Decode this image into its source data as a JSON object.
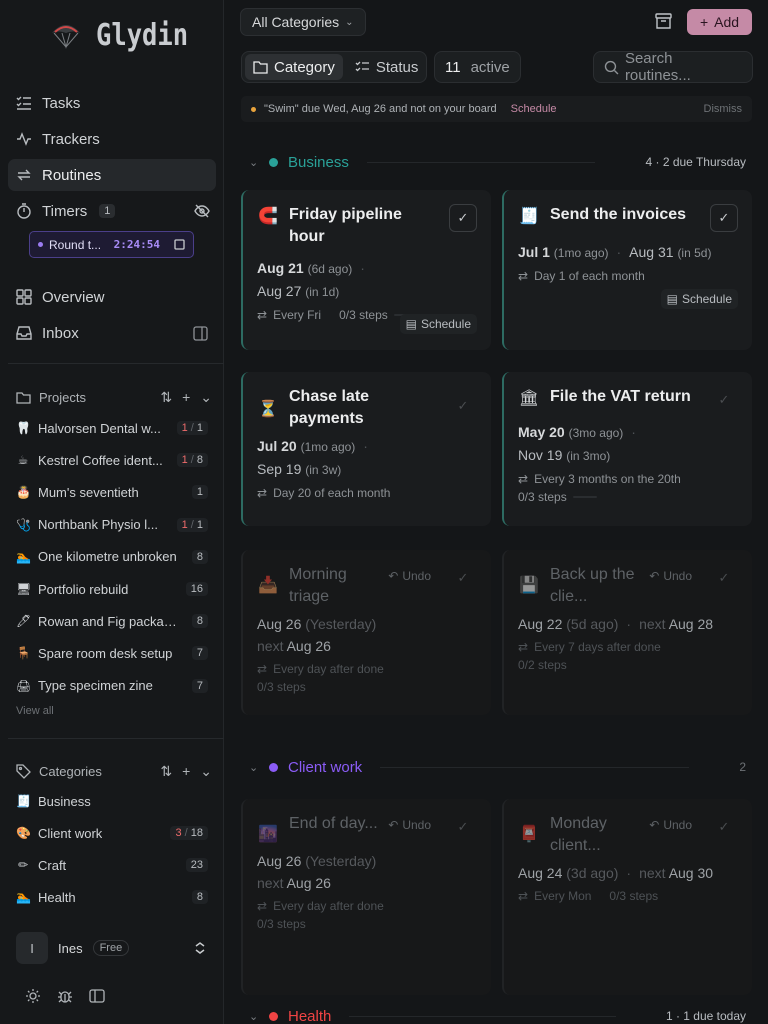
{
  "app": {
    "name": "Glydin"
  },
  "nav": {
    "tasks": "Tasks",
    "trackers": "Trackers",
    "routines": "Routines",
    "timers": "Timers",
    "timers_count": "1",
    "overview": "Overview",
    "inbox": "Inbox"
  },
  "timer": {
    "label": "Round t...",
    "time": "2:24:54"
  },
  "projects": {
    "title": "Projects",
    "items": [
      {
        "emoji": "🦷",
        "label": "Halvorsen Dental w...",
        "overdue": "1",
        "total": "1"
      },
      {
        "emoji": "☕",
        "label": "Kestrel Coffee ident...",
        "overdue": "1",
        "total": "8"
      },
      {
        "emoji": "🎂",
        "label": "Mum's seventieth",
        "count": "1"
      },
      {
        "emoji": "🩺",
        "label": "Northbank Physio l...",
        "overdue": "1",
        "total": "1"
      },
      {
        "emoji": "🏊",
        "label": "One kilometre unbroken",
        "count": "8"
      },
      {
        "emoji": "🖥",
        "label": "Portfolio rebuild",
        "count": "16"
      },
      {
        "emoji": "🖊",
        "label": "Rowan and Fig packagi...",
        "count": "8"
      },
      {
        "emoji": "🪑",
        "label": "Spare room desk setup",
        "count": "7"
      },
      {
        "emoji": "🖨",
        "label": "Type specimen zine",
        "count": "7"
      }
    ],
    "view_all": "View all"
  },
  "categories": {
    "title": "Categories",
    "items": [
      {
        "emoji": "🧾",
        "label": "Business"
      },
      {
        "emoji": "🎨",
        "label": "Client work",
        "overdue": "3",
        "total": "18"
      },
      {
        "emoji": "✏",
        "label": "Craft",
        "count": "23"
      },
      {
        "emoji": "🏊",
        "label": "Health",
        "count": "8"
      }
    ]
  },
  "user": {
    "initial": "I",
    "name": "Ines",
    "plan": "Free"
  },
  "toolbar": {
    "filter": "All Categories",
    "add": "Add",
    "seg_category": "Category",
    "seg_status": "Status",
    "active_num": "11",
    "active_word": "active",
    "search_placeholder": "Search routines..."
  },
  "notice": {
    "text": "\"Swim\" due Wed, Aug 26 and not on your board",
    "action": "Schedule",
    "dismiss": "Dismiss"
  },
  "groups": {
    "business": {
      "name": "Business",
      "meta": "4 · 2 due Thursday",
      "color": "#2aa198"
    },
    "client": {
      "name": "Client work",
      "meta": "2",
      "color": "#8b5cf6"
    },
    "health": {
      "name": "Health",
      "meta": "1 · 1 due today",
      "color": "#ef4444"
    }
  },
  "cards": {
    "friday": {
      "emoji": "🧲",
      "title": "Friday pipeline hour",
      "last": "Aug 21",
      "last_rel": "(6d ago)",
      "next": "Aug 27",
      "next_rel": "(in 1d)",
      "repeat": "Every Fri",
      "steps": "0/3 steps",
      "schedule": "Schedule"
    },
    "invoices": {
      "emoji": "🧾",
      "title": "Send the invoices",
      "last": "Jul 1",
      "last_rel": "(1mo ago)",
      "next": "Aug 31",
      "next_rel": "(in 5d)",
      "repeat": "Day 1 of each month",
      "schedule": "Schedule"
    },
    "chase": {
      "emoji": "⏳",
      "title": "Chase late payments",
      "last": "Jul 20",
      "last_rel": "(1mo ago)",
      "next": "Sep 19",
      "next_rel": "(in 3w)",
      "repeat": "Day 20 of each month"
    },
    "vat": {
      "emoji": "🏛",
      "title": "File the VAT return",
      "last": "May 20",
      "last_rel": "(3mo ago)",
      "next": "Nov 19",
      "next_rel": "(in 3mo)",
      "repeat": "Every 3 months on the 20th",
      "steps": "0/3 steps"
    },
    "triage": {
      "emoji": "📥",
      "title": "Morning triage",
      "undo": "Undo",
      "last": "Aug 26",
      "last_rel": "(Yesterday)",
      "next_word": "next",
      "next": "Aug 26",
      "repeat": "Every day after done",
      "steps": "0/3 steps"
    },
    "backup": {
      "emoji": "💾",
      "title": "Back up the clie...",
      "undo": "Undo",
      "last": "Aug 22",
      "last_rel": "(5d ago)",
      "next_word": "next",
      "next": "Aug 28",
      "repeat": "Every 7 days after done",
      "steps": "0/2 steps"
    },
    "endofday": {
      "emoji": "🌆",
      "title": "End of day...",
      "undo": "Undo",
      "last": "Aug 26",
      "last_rel": "(Yesterday)",
      "next_word": "next",
      "next": "Aug 26",
      "repeat": "Every day after done",
      "steps": "0/3 steps"
    },
    "monday": {
      "emoji": "📮",
      "title": "Monday client...",
      "undo": "Undo",
      "last": "Aug 24",
      "last_rel": "(3d ago)",
      "next_word": "next",
      "next": "Aug 30",
      "repeat": "Every Mon",
      "steps": "0/3 steps"
    }
  }
}
